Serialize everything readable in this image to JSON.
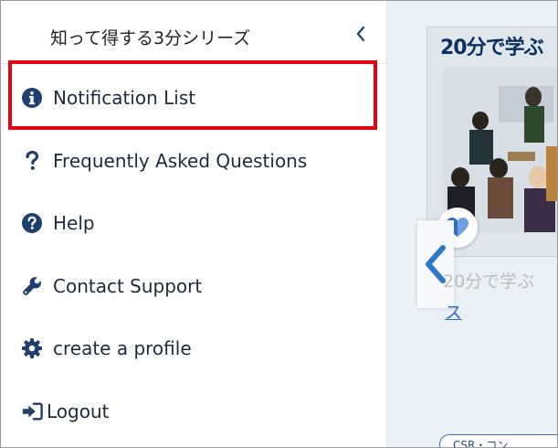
{
  "drawer": {
    "title": "知って得する3分シリーズ",
    "items": [
      {
        "label": "Notification List",
        "icon": "info-circle-icon"
      },
      {
        "label": "Frequently Asked Questions",
        "icon": "question-mark-icon"
      },
      {
        "label": "Help",
        "icon": "question-circle-icon"
      },
      {
        "label": "Contact Support",
        "icon": "wrench-icon"
      },
      {
        "label": "create a profile",
        "icon": "gear-icon"
      },
      {
        "label": "Logout",
        "icon": "logout-icon"
      }
    ]
  },
  "background": {
    "thumb_title": "20分で学ぶ",
    "card_text": "20分で学ぶ",
    "card_link": "ス",
    "tag": "CSR・コン"
  },
  "colors": {
    "accent": "#1f3f6e",
    "highlight": "#e20613",
    "link": "#2f68c9"
  }
}
